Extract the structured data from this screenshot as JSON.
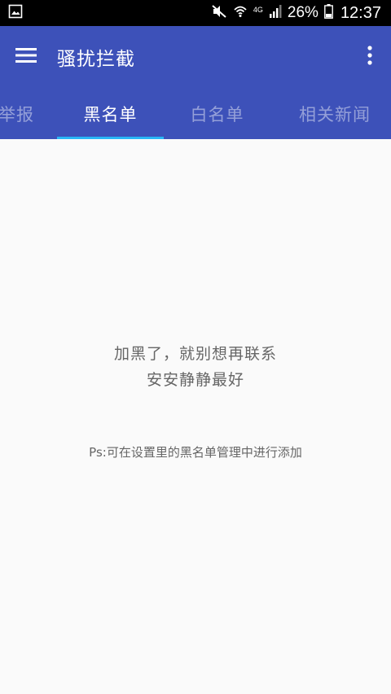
{
  "status_bar": {
    "network_type": "4G",
    "battery_percent": "26%",
    "time": "12:37",
    "icons": [
      "gallery-notification-icon",
      "mute-icon",
      "wifi-icon",
      "signal-icon",
      "battery-icon"
    ]
  },
  "app_bar": {
    "title": "骚扰拦截",
    "icons": [
      "hamburger-menu-icon",
      "more-vert-icon"
    ]
  },
  "tabs": [
    {
      "label": "举报",
      "active": false
    },
    {
      "label": "黑名单",
      "active": true
    },
    {
      "label": "白名单",
      "active": false
    },
    {
      "label": "相关新闻",
      "active": false
    }
  ],
  "empty_state": {
    "line1": "加黑了，就别想再联系",
    "line2": "安安静静最好",
    "hint": "Ps:可在设置里的黑名单管理中进行添加"
  },
  "colors": {
    "primary": "#3d51b9",
    "indicator": "#29b6f6",
    "background": "#fafafa",
    "text_secondary": "#666666"
  }
}
